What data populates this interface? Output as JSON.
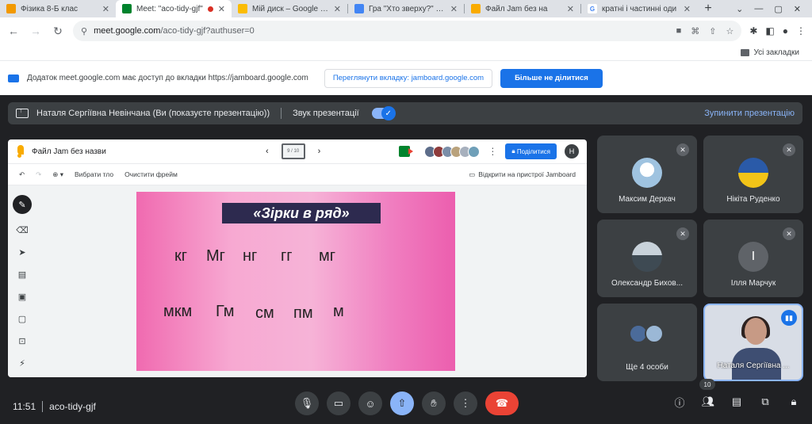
{
  "browser": {
    "tabs": [
      {
        "label": "Фізика 8-Б клас",
        "favicon_color": "#f29900",
        "favicon_text": "",
        "active": false
      },
      {
        "label": "Meet: \"aco-tidy-gjf\"",
        "favicon_color": "#00832d",
        "favicon_text": "",
        "active": true,
        "recording": true
      },
      {
        "label": "Мій диск – Google Ди",
        "favicon_color": "#fbbc04",
        "favicon_text": "",
        "active": false
      },
      {
        "label": "Гра \"Хто зверху?\" - Go",
        "favicon_color": "#4285f4",
        "favicon_text": "",
        "active": false
      },
      {
        "label": "Файл Jam без на",
        "favicon_color": "#f9ab00",
        "favicon_text": "",
        "active": false
      },
      {
        "label": "кратні і частинні оди",
        "favicon_color": "#ffffff",
        "favicon_text": "G",
        "active": false
      }
    ],
    "new_tab": "+",
    "url_host": "meet.google.com",
    "url_path": "/aco-tidy-gjf?authuser=0",
    "bookmarks_label": "Усі закладки"
  },
  "infobar": {
    "message": "Додаток meet.google.com має доступ до вкладки https://jamboard.google.com",
    "view_tab_button": "Переглянути вкладку: jamboard.google.com",
    "stop_sharing_button": "Більше не ділитися"
  },
  "meet": {
    "banner": {
      "presenter_text": "Наталя Сергіївна Невінчана (Ви (показуєте презентацію))",
      "sound_label": "Звук презентації",
      "stop_label": "Зупинити презентацію"
    },
    "jamboard": {
      "file_title": "Файл Jam без назви",
      "frame_counter": "9 / 10",
      "share_button": "Поділитися",
      "user_initial": "Н",
      "toolbar": {
        "set_background": "Вибрати тло",
        "clear_frame": "Очистити фрейм",
        "open_on_device": "Відкрити на пристрої Jamboard"
      },
      "slide": {
        "title": "«Зірки в ряд»",
        "row1": [
          "кг",
          "Мг",
          "нг",
          "гг",
          "мг"
        ],
        "row2": [
          "мкм",
          "Гм",
          "см",
          "пм",
          "м"
        ]
      }
    },
    "participants": [
      {
        "name": "Максим Деркач",
        "muted": true
      },
      {
        "name": "Нікіта Руденко",
        "muted": true
      },
      {
        "name": "Олександр Бихов...",
        "muted": true
      },
      {
        "name": "Ілля Марчук",
        "initial": "І",
        "muted": true
      }
    ],
    "more_people": "Ще 4 особи",
    "self_name": "Наталя Сергіївна ...",
    "bottom": {
      "time": "11:51",
      "meeting_code": "aco-tidy-gjf",
      "participant_count": "10"
    }
  }
}
